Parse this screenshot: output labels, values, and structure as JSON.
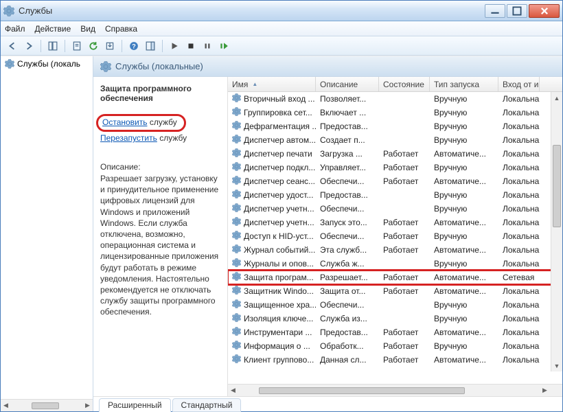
{
  "window": {
    "title": "Службы"
  },
  "menu": {
    "file": "Файл",
    "action": "Действие",
    "view": "Вид",
    "help": "Справка"
  },
  "tree": {
    "root": "Службы (локаль"
  },
  "pane": {
    "title": "Службы (локальные)"
  },
  "detail": {
    "service_name": "Защита программного обеспечения",
    "stop_link": "Остановить",
    "stop_suffix": " службу",
    "restart_link": "Перезапустить",
    "restart_suffix": " службу",
    "desc_label": "Описание:",
    "desc_text": "Разрешает загрузку, установку и принудительное применение цифровых лицензий для Windows и приложений Windows. Если служба отключена, возможно, операционная система и лицензированные приложения будут работать в режиме уведомления. Настоятельно рекомендуется не отключать службу защиты программного обеспечения."
  },
  "columns": {
    "name": "Имя",
    "desc": "Описание",
    "state": "Состояние",
    "startup": "Тип запуска",
    "logon": "Вход от и"
  },
  "tabs": {
    "extended": "Расширенный",
    "standard": "Стандартный"
  },
  "rows": [
    {
      "name": "Вторичный вход ...",
      "desc": "Позволяет...",
      "state": "",
      "startup": "Вручную",
      "logon": "Локальна"
    },
    {
      "name": "Группировка сет...",
      "desc": "Включает ...",
      "state": "",
      "startup": "Вручную",
      "logon": "Локальна"
    },
    {
      "name": "Дефрагментация ...",
      "desc": "Предостав...",
      "state": "",
      "startup": "Вручную",
      "logon": "Локальна"
    },
    {
      "name": "Диспетчер автом...",
      "desc": "Создает п...",
      "state": "",
      "startup": "Вручную",
      "logon": "Локальна"
    },
    {
      "name": "Диспетчер печати",
      "desc": "Загрузка ...",
      "state": "Работает",
      "startup": "Автоматиче...",
      "logon": "Локальна"
    },
    {
      "name": "Диспетчер подкл...",
      "desc": "Управляет...",
      "state": "Работает",
      "startup": "Вручную",
      "logon": "Локальна"
    },
    {
      "name": "Диспетчер сеанс...",
      "desc": "Обеспечи...",
      "state": "Работает",
      "startup": "Автоматиче...",
      "logon": "Локальна"
    },
    {
      "name": "Диспетчер удост...",
      "desc": "Предостав...",
      "state": "",
      "startup": "Вручную",
      "logon": "Локальна"
    },
    {
      "name": "Диспетчер учетн...",
      "desc": "Обеспечи...",
      "state": "",
      "startup": "Вручную",
      "logon": "Локальна"
    },
    {
      "name": "Диспетчер учетн...",
      "desc": "Запуск это...",
      "state": "Работает",
      "startup": "Автоматиче...",
      "logon": "Локальна"
    },
    {
      "name": "Доступ к HID-уст...",
      "desc": "Обеспечи...",
      "state": "Работает",
      "startup": "Вручную",
      "logon": "Локальна"
    },
    {
      "name": "Журнал событий...",
      "desc": "Эта служб...",
      "state": "Работает",
      "startup": "Автоматиче...",
      "logon": "Локальна"
    },
    {
      "name": "Журналы и опов...",
      "desc": "Служба ж...",
      "state": "",
      "startup": "Вручную",
      "logon": "Локальна"
    },
    {
      "name": "Защита програм...",
      "desc": "Разрешает...",
      "state": "Работает",
      "startup": "Автоматиче...",
      "logon": "Сетевая",
      "hl": true
    },
    {
      "name": "Защитник Windo...",
      "desc": "Защита от...",
      "state": "Работает",
      "startup": "Автоматиче...",
      "logon": "Локальна"
    },
    {
      "name": "Защищенное хра...",
      "desc": "Обеспечи...",
      "state": "",
      "startup": "Вручную",
      "logon": "Локальна"
    },
    {
      "name": "Изоляция ключе...",
      "desc": "Служба из...",
      "state": "",
      "startup": "Вручную",
      "logon": "Локальна"
    },
    {
      "name": "Инструментари ...",
      "desc": "Предостав...",
      "state": "Работает",
      "startup": "Автоматиче...",
      "logon": "Локальна"
    },
    {
      "name": "Информация о ...",
      "desc": "Обработк...",
      "state": "Работает",
      "startup": "Вручную",
      "logon": "Локальна"
    },
    {
      "name": "Клиент группово...",
      "desc": "Данная сл...",
      "state": "Работает",
      "startup": "Автоматиче...",
      "logon": "Локальна"
    }
  ]
}
